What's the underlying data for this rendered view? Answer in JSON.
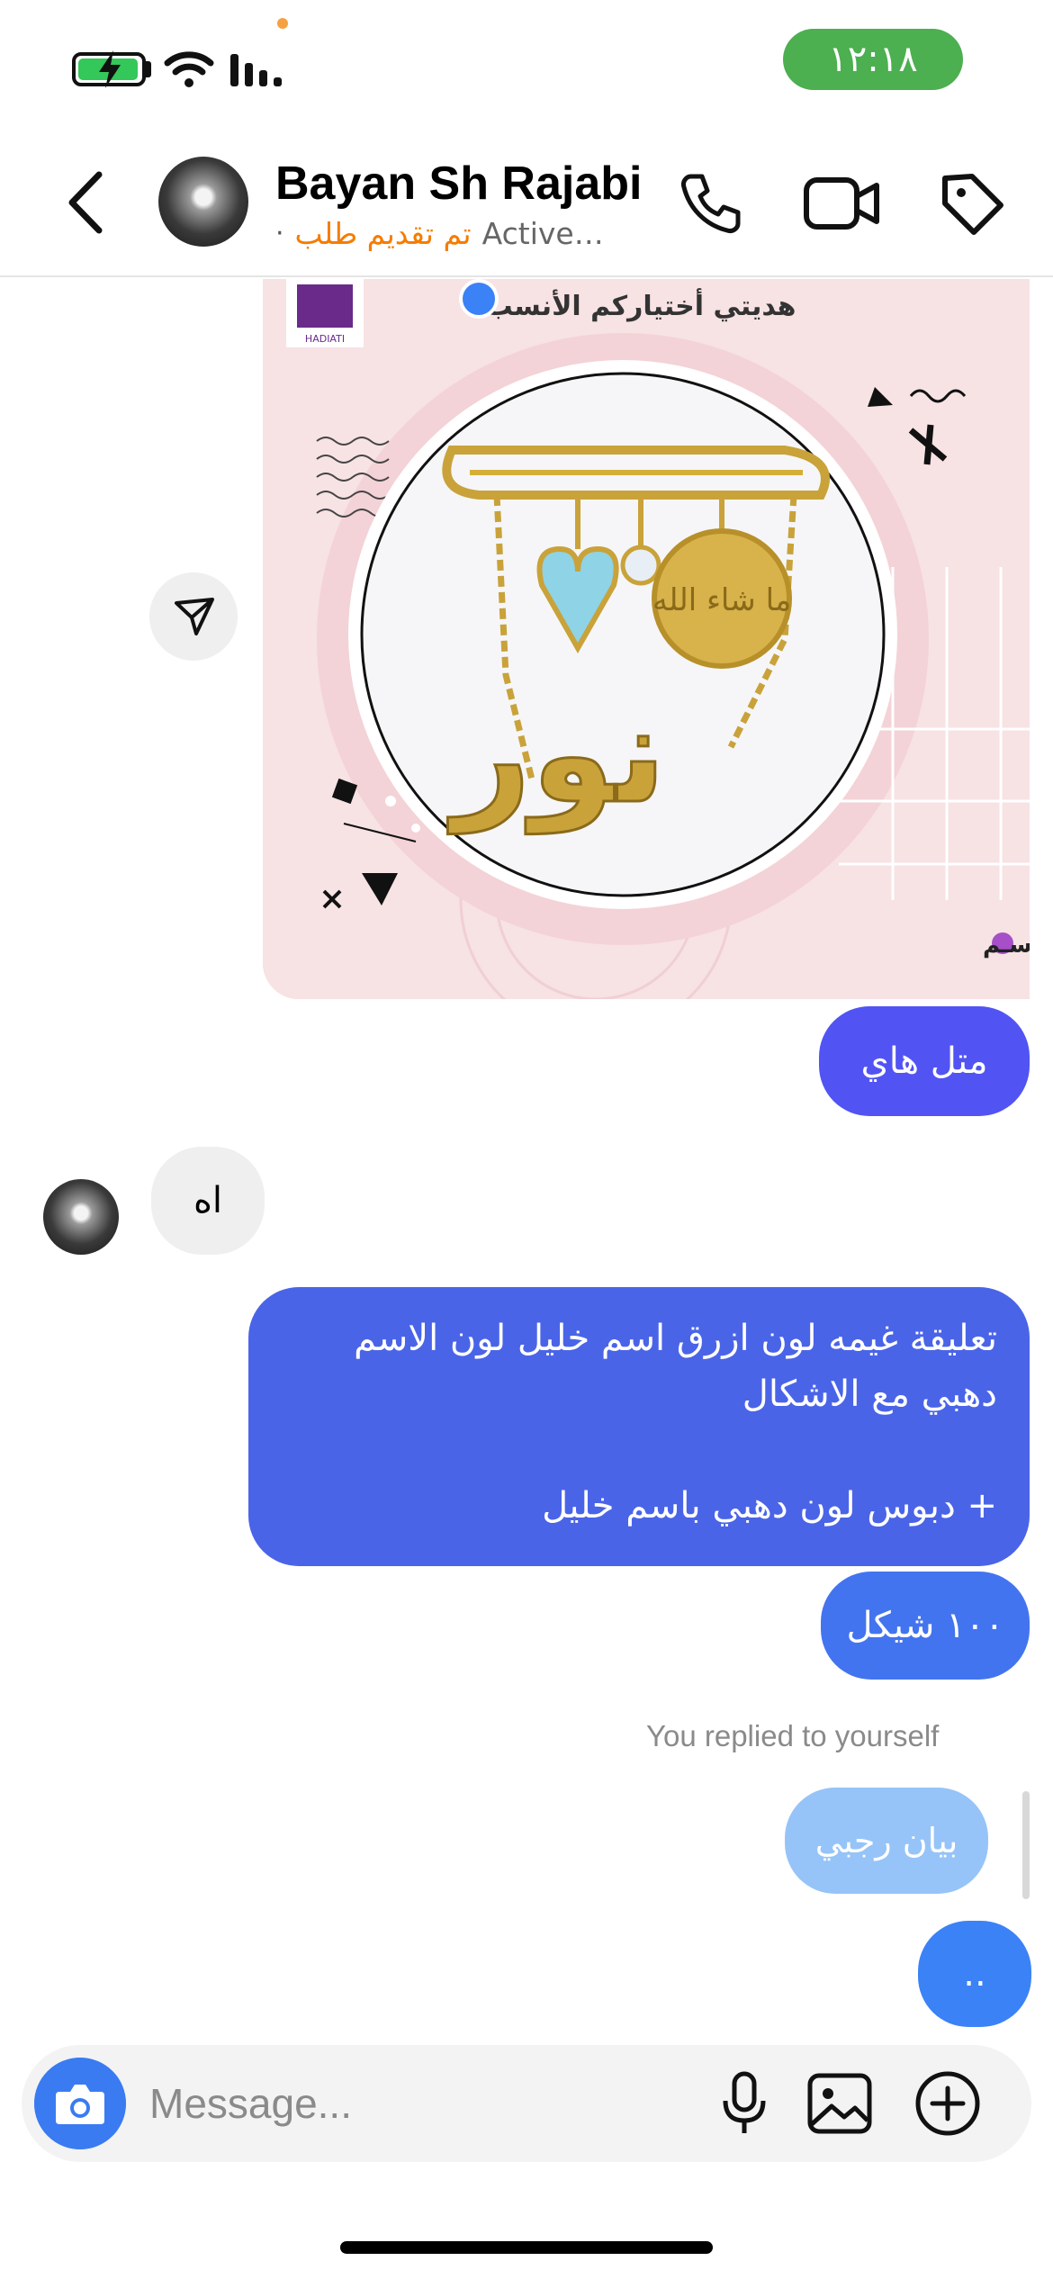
{
  "status_bar": {
    "time": "١٢:١٨"
  },
  "header": {
    "contact_name": "Bayan Sh Rajabi",
    "status_dot": "·",
    "status_label": "تم تقديم طلب",
    "status_active": "Active…"
  },
  "product_image": {
    "header_text": "هديتي أختياركم الأنسب",
    "brand_text": "HADIATI",
    "caption": "دبـوس بالاسـم",
    "name_charm": "نور",
    "disc_text": "ما شاء الله"
  },
  "messages": {
    "out_1": "متل هاي",
    "in_1": "اه",
    "out_2_line1": "تعليقة غيمه لون ازرق اسم خليل لون الاسم",
    "out_2_line2": "دهبي مع الاشكال",
    "out_2_line3": "+ دبوس لون دهبي باسم خليل",
    "out_3": "١٠٠ شيكل",
    "replied_label": "You replied to yourself",
    "reply_quote": "بيان رجبي",
    "out_4": ".."
  },
  "composer": {
    "placeholder": "Message..."
  },
  "icons": {
    "battery": "battery-charging-icon",
    "wifi": "wifi-icon",
    "signal": "signal-icon",
    "back": "chevron-left-icon",
    "call": "phone-icon",
    "video": "video-camera-icon",
    "tag": "tag-icon",
    "share": "send-icon",
    "camera": "camera-icon",
    "mic": "microphone-icon",
    "gallery": "image-icon",
    "plus": "plus-circle-icon"
  },
  "colors": {
    "time_pill": "#4caf50",
    "outgoing_purple": "#5154f3",
    "outgoing_blue": "#4a64e8",
    "reply_light": "#96c4f8",
    "status_orange": "#f57c00",
    "camera_button": "#3a7bf2"
  }
}
